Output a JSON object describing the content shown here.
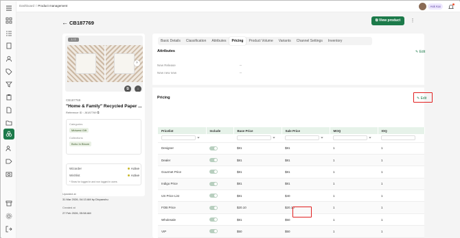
{
  "breadcrumb": {
    "root": "Dashboard",
    "current": "Product management"
  },
  "user": {
    "name": "Ask Kai",
    "org_initial": "D"
  },
  "header": {
    "title": "CB187769",
    "view_button": "View product",
    "more": "⋮"
  },
  "product": {
    "image_count": "1 / 2",
    "sku": "CB187769",
    "name": "\"Home & Family\" Recycled Paper ...",
    "reference": "Reference ID : J6187769",
    "categories_label": "Categories",
    "category": "Midwest Gift",
    "collections_label": "Collections",
    "collection": "Boho In Bloom",
    "visibility": [
      {
        "label": "Wizarder",
        "status": "Active"
      },
      {
        "label": "Wishlist",
        "status": "Active"
      }
    ],
    "visibility_note": "* Show for logged in and non logged in users",
    "updated_label": "Updated at",
    "updated_value": "31 Mar 2026, 04:13 AM by Divyanshu",
    "created_label": "Created at",
    "created_value": "27 Feb 2026, 05:58 AM"
  },
  "tabs": [
    {
      "label": "Basic Details",
      "active": false
    },
    {
      "label": "Classification",
      "active": false
    },
    {
      "label": "Attributes",
      "active": false
    },
    {
      "label": "Pricing",
      "active": true
    },
    {
      "label": "Product Volume",
      "active": false
    },
    {
      "label": "Variants",
      "active": false
    },
    {
      "label": "Channel Settings",
      "active": false
    },
    {
      "label": "Inventory",
      "active": false
    }
  ],
  "attributes": {
    "title": "Attributes",
    "edit": "Edit",
    "rows": [
      {
        "label": "New Release",
        "value": "--"
      },
      {
        "label": "New new new",
        "value": "--"
      }
    ]
  },
  "pricing": {
    "title": "Pricing",
    "edit": "Edit",
    "columns": [
      "Pricelist",
      "Include",
      "Base Price",
      "Sale Price",
      "MOQ",
      "IOQ"
    ],
    "rows": [
      {
        "pricelist": "Designer",
        "base": "$81",
        "sale": "$81",
        "moq": "1",
        "ioq": "1"
      },
      {
        "pricelist": "Dealer",
        "base": "$81",
        "sale": "$81",
        "moq": "1",
        "ioq": "1"
      },
      {
        "pricelist": "Gourmet Price",
        "base": "$81",
        "sale": "$81",
        "moq": "1",
        "ioq": "1"
      },
      {
        "pricelist": "Indigo Price",
        "base": "$81",
        "sale": "$81",
        "moq": "1",
        "ioq": "1"
      },
      {
        "pricelist": "US Price List",
        "base": "$81",
        "sale": "$40",
        "moq": "1",
        "ioq": "1"
      },
      {
        "pricelist": "FOB Price",
        "base": "$20.10",
        "sale": "$20.10",
        "moq": "1",
        "ioq": "1"
      },
      {
        "pricelist": "Wholesale",
        "base": "$81",
        "sale": "$50",
        "moq": "1",
        "ioq": "1"
      },
      {
        "pricelist": "VIP",
        "base": "$50",
        "sale": "$50",
        "moq": "1",
        "ioq": "1"
      }
    ]
  },
  "colors": {
    "brand": "#1c7a4a",
    "highlight": "#e01b1b",
    "header_row": "#e6f2e9"
  }
}
